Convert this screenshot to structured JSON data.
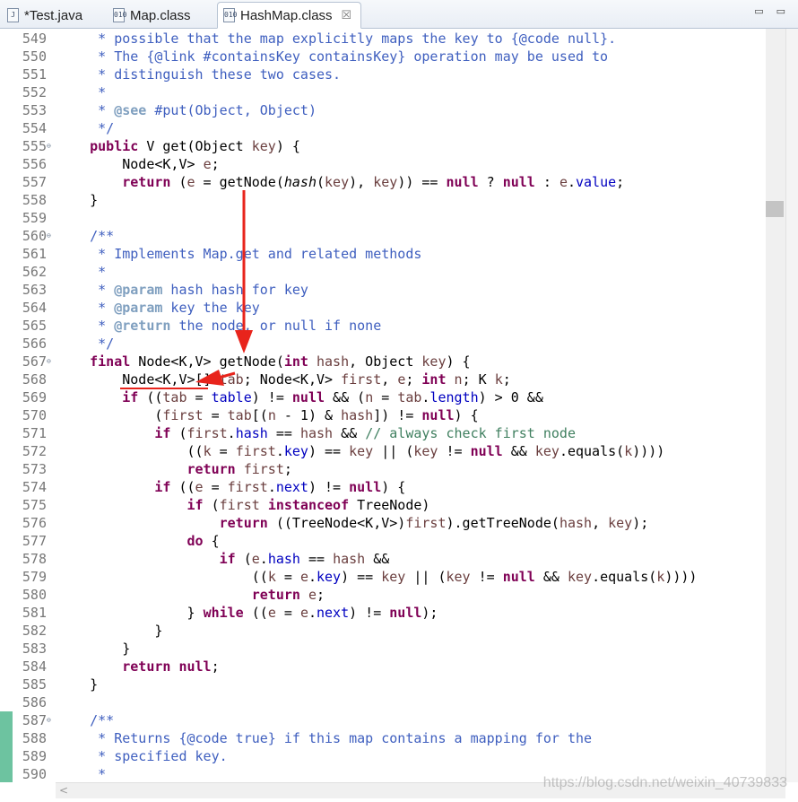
{
  "tabs": [
    {
      "label": "*Test.java",
      "icon": "java-file-icon",
      "icon_glyph": "J",
      "active": false
    },
    {
      "label": "Map.class",
      "icon": "class-file-icon",
      "icon_glyph": "010",
      "active": false
    },
    {
      "label": "HashMap.class",
      "icon": "class-file-icon",
      "icon_glyph": "010",
      "active": true,
      "close": "☒"
    }
  ],
  "window_buttons": {
    "minimize": "▭",
    "maximize": "▭"
  },
  "editor": {
    "lines": [
      {
        "n": "549",
        "fold": "",
        "segs": [
          [
            "cm",
            "     * possible that the map explicitly maps the key to {@code null}."
          ]
        ]
      },
      {
        "n": "550",
        "fold": "",
        "segs": [
          [
            "cm",
            "     * The {@link #containsKey containsKey} operation may be used to"
          ]
        ]
      },
      {
        "n": "551",
        "fold": "",
        "segs": [
          [
            "cm",
            "     * distinguish these two cases."
          ]
        ]
      },
      {
        "n": "552",
        "fold": "",
        "segs": [
          [
            "cm",
            "     *"
          ]
        ]
      },
      {
        "n": "553",
        "fold": "",
        "segs": [
          [
            "cm",
            "     * "
          ],
          [
            "tag",
            "@see"
          ],
          [
            "cm",
            " #put(Object, Object)"
          ]
        ]
      },
      {
        "n": "554",
        "fold": "",
        "segs": [
          [
            "cm",
            "     */"
          ]
        ]
      },
      {
        "n": "555",
        "fold": "⊖",
        "segs": [
          [
            "",
            "    "
          ],
          [
            "kw",
            "public"
          ],
          [
            "",
            " V get(Object "
          ],
          [
            "var",
            "key"
          ],
          [
            "",
            ") {"
          ]
        ]
      },
      {
        "n": "556",
        "fold": "",
        "segs": [
          [
            "",
            "        Node<K,V> "
          ],
          [
            "var",
            "e"
          ],
          [
            "",
            ";"
          ]
        ]
      },
      {
        "n": "557",
        "fold": "",
        "segs": [
          [
            "",
            "        "
          ],
          [
            "kw",
            "return"
          ],
          [
            "",
            " ("
          ],
          [
            "var",
            "e"
          ],
          [
            "",
            " = getNode("
          ],
          [
            "it",
            "hash"
          ],
          [
            "",
            "("
          ],
          [
            "var",
            "key"
          ],
          [
            "",
            "), "
          ],
          [
            "var",
            "key"
          ],
          [
            "",
            ")) == "
          ],
          [
            "kw",
            "null"
          ],
          [
            "",
            " ? "
          ],
          [
            "kw",
            "null"
          ],
          [
            "",
            " : "
          ],
          [
            "var",
            "e"
          ],
          [
            "",
            "."
          ],
          [
            "fld",
            "value"
          ],
          [
            "",
            ";"
          ]
        ]
      },
      {
        "n": "558",
        "fold": "",
        "segs": [
          [
            "",
            "    }"
          ]
        ]
      },
      {
        "n": "559",
        "fold": "",
        "segs": [
          [
            "",
            ""
          ]
        ]
      },
      {
        "n": "560",
        "fold": "⊖",
        "segs": [
          [
            "cm",
            "    /**"
          ]
        ]
      },
      {
        "n": "561",
        "fold": "",
        "segs": [
          [
            "cm",
            "     * Implements Map.get and related methods"
          ]
        ]
      },
      {
        "n": "562",
        "fold": "",
        "segs": [
          [
            "cm",
            "     *"
          ]
        ]
      },
      {
        "n": "563",
        "fold": "",
        "segs": [
          [
            "cm",
            "     * "
          ],
          [
            "tag",
            "@param"
          ],
          [
            "cm",
            " hash hash for key"
          ]
        ]
      },
      {
        "n": "564",
        "fold": "",
        "segs": [
          [
            "cm",
            "     * "
          ],
          [
            "tag",
            "@param"
          ],
          [
            "cm",
            " key the key"
          ]
        ]
      },
      {
        "n": "565",
        "fold": "",
        "segs": [
          [
            "cm",
            "     * "
          ],
          [
            "tag",
            "@return"
          ],
          [
            "cm",
            " the node, or null if none"
          ]
        ]
      },
      {
        "n": "566",
        "fold": "",
        "segs": [
          [
            "cm",
            "     */"
          ]
        ]
      },
      {
        "n": "567",
        "fold": "⊖",
        "segs": [
          [
            "",
            "    "
          ],
          [
            "kw",
            "final"
          ],
          [
            "",
            " Node<K,V> getNode("
          ],
          [
            "kw",
            "int"
          ],
          [
            "",
            " "
          ],
          [
            "var",
            "hash"
          ],
          [
            "",
            ", Object "
          ],
          [
            "var",
            "key"
          ],
          [
            "",
            ") {"
          ]
        ]
      },
      {
        "n": "568",
        "fold": "",
        "segs": [
          [
            "",
            "        Node<K,V>[] "
          ],
          [
            "var",
            "tab"
          ],
          [
            "",
            "; Node<K,V> "
          ],
          [
            "var",
            "first"
          ],
          [
            "",
            ", "
          ],
          [
            "var",
            "e"
          ],
          [
            "",
            "; "
          ],
          [
            "kw",
            "int"
          ],
          [
            "",
            " "
          ],
          [
            "var",
            "n"
          ],
          [
            "",
            "; K "
          ],
          [
            "var",
            "k"
          ],
          [
            "",
            ";"
          ]
        ]
      },
      {
        "n": "569",
        "fold": "",
        "segs": [
          [
            "",
            "        "
          ],
          [
            "kw",
            "if"
          ],
          [
            "",
            " (("
          ],
          [
            "var",
            "tab"
          ],
          [
            "",
            " = "
          ],
          [
            "fld",
            "table"
          ],
          [
            "",
            ") != "
          ],
          [
            "kw",
            "null"
          ],
          [
            "",
            " && ("
          ],
          [
            "var",
            "n"
          ],
          [
            "",
            " = "
          ],
          [
            "var",
            "tab"
          ],
          [
            "",
            "."
          ],
          [
            "fld",
            "length"
          ],
          [
            "",
            ") > 0 &&"
          ]
        ]
      },
      {
        "n": "570",
        "fold": "",
        "segs": [
          [
            "",
            "            ("
          ],
          [
            "var",
            "first"
          ],
          [
            "",
            " = "
          ],
          [
            "var",
            "tab"
          ],
          [
            "",
            "[("
          ],
          [
            "var",
            "n"
          ],
          [
            "",
            " - 1) & "
          ],
          [
            "var",
            "hash"
          ],
          [
            "",
            "]) != "
          ],
          [
            "kw",
            "null"
          ],
          [
            "",
            ") {"
          ]
        ]
      },
      {
        "n": "571",
        "fold": "",
        "segs": [
          [
            "",
            "            "
          ],
          [
            "kw",
            "if"
          ],
          [
            "",
            " ("
          ],
          [
            "var",
            "first"
          ],
          [
            "",
            "."
          ],
          [
            "fld",
            "hash"
          ],
          [
            "",
            " == "
          ],
          [
            "var",
            "hash"
          ],
          [
            "",
            " && "
          ],
          [
            "gc",
            "// always check first node"
          ]
        ]
      },
      {
        "n": "572",
        "fold": "",
        "segs": [
          [
            "",
            "                (("
          ],
          [
            "var",
            "k"
          ],
          [
            "",
            " = "
          ],
          [
            "var",
            "first"
          ],
          [
            "",
            "."
          ],
          [
            "fld",
            "key"
          ],
          [
            "",
            ") == "
          ],
          [
            "var",
            "key"
          ],
          [
            "",
            " || ("
          ],
          [
            "var",
            "key"
          ],
          [
            "",
            " != "
          ],
          [
            "kw",
            "null"
          ],
          [
            "",
            " && "
          ],
          [
            "var",
            "key"
          ],
          [
            "",
            ".equals("
          ],
          [
            "var",
            "k"
          ],
          [
            "",
            ")))) "
          ]
        ]
      },
      {
        "n": "573",
        "fold": "",
        "segs": [
          [
            "",
            "                "
          ],
          [
            "kw",
            "return"
          ],
          [
            "",
            " "
          ],
          [
            "var",
            "first"
          ],
          [
            "",
            ";"
          ]
        ]
      },
      {
        "n": "574",
        "fold": "",
        "segs": [
          [
            "",
            "            "
          ],
          [
            "kw",
            "if"
          ],
          [
            "",
            " (("
          ],
          [
            "var",
            "e"
          ],
          [
            "",
            " = "
          ],
          [
            "var",
            "first"
          ],
          [
            "",
            "."
          ],
          [
            "fld",
            "next"
          ],
          [
            "",
            ") != "
          ],
          [
            "kw",
            "null"
          ],
          [
            "",
            ") {"
          ]
        ]
      },
      {
        "n": "575",
        "fold": "",
        "segs": [
          [
            "",
            "                "
          ],
          [
            "kw",
            "if"
          ],
          [
            "",
            " ("
          ],
          [
            "var",
            "first"
          ],
          [
            "",
            " "
          ],
          [
            "kw",
            "instanceof"
          ],
          [
            "",
            " TreeNode)"
          ]
        ]
      },
      {
        "n": "576",
        "fold": "",
        "segs": [
          [
            "",
            "                    "
          ],
          [
            "kw",
            "return"
          ],
          [
            "",
            " ((TreeNode<K,V>)"
          ],
          [
            "var",
            "first"
          ],
          [
            "",
            ").getTreeNode("
          ],
          [
            "var",
            "hash"
          ],
          [
            "",
            ", "
          ],
          [
            "var",
            "key"
          ],
          [
            "",
            ");"
          ]
        ]
      },
      {
        "n": "577",
        "fold": "",
        "segs": [
          [
            "",
            "                "
          ],
          [
            "kw",
            "do"
          ],
          [
            "",
            " {"
          ]
        ]
      },
      {
        "n": "578",
        "fold": "",
        "segs": [
          [
            "",
            "                    "
          ],
          [
            "kw",
            "if"
          ],
          [
            "",
            " ("
          ],
          [
            "var",
            "e"
          ],
          [
            "",
            "."
          ],
          [
            "fld",
            "hash"
          ],
          [
            "",
            " == "
          ],
          [
            "var",
            "hash"
          ],
          [
            "",
            " &&"
          ]
        ]
      },
      {
        "n": "579",
        "fold": "",
        "segs": [
          [
            "",
            "                        (("
          ],
          [
            "var",
            "k"
          ],
          [
            "",
            " = "
          ],
          [
            "var",
            "e"
          ],
          [
            "",
            "."
          ],
          [
            "fld",
            "key"
          ],
          [
            "",
            ") == "
          ],
          [
            "var",
            "key"
          ],
          [
            "",
            " || ("
          ],
          [
            "var",
            "key"
          ],
          [
            "",
            " != "
          ],
          [
            "kw",
            "null"
          ],
          [
            "",
            " && "
          ],
          [
            "var",
            "key"
          ],
          [
            "",
            ".equals("
          ],
          [
            "var",
            "k"
          ],
          [
            "",
            "))))"
          ]
        ]
      },
      {
        "n": "580",
        "fold": "",
        "segs": [
          [
            "",
            "                        "
          ],
          [
            "kw",
            "return"
          ],
          [
            "",
            " "
          ],
          [
            "var",
            "e"
          ],
          [
            "",
            ";"
          ]
        ]
      },
      {
        "n": "581",
        "fold": "",
        "segs": [
          [
            "",
            "                } "
          ],
          [
            "kw",
            "while"
          ],
          [
            "",
            " (("
          ],
          [
            "var",
            "e"
          ],
          [
            "",
            " = "
          ],
          [
            "var",
            "e"
          ],
          [
            "",
            "."
          ],
          [
            "fld",
            "next"
          ],
          [
            "",
            ") != "
          ],
          [
            "kw",
            "null"
          ],
          [
            "",
            ");"
          ]
        ]
      },
      {
        "n": "582",
        "fold": "",
        "segs": [
          [
            "",
            "            }"
          ]
        ]
      },
      {
        "n": "583",
        "fold": "",
        "segs": [
          [
            "",
            "        }"
          ]
        ]
      },
      {
        "n": "584",
        "fold": "",
        "segs": [
          [
            "",
            "        "
          ],
          [
            "kw",
            "return"
          ],
          [
            "",
            " "
          ],
          [
            "kw",
            "null"
          ],
          [
            "",
            ";"
          ]
        ]
      },
      {
        "n": "585",
        "fold": "",
        "segs": [
          [
            "",
            "    }"
          ]
        ]
      },
      {
        "n": "586",
        "fold": "",
        "segs": [
          [
            "",
            ""
          ]
        ]
      },
      {
        "n": "587",
        "fold": "⊖",
        "changed": true,
        "segs": [
          [
            "cm",
            "    /**"
          ]
        ]
      },
      {
        "n": "588",
        "fold": "",
        "changed": true,
        "segs": [
          [
            "cm",
            "     * Returns {@code true} if this map contains a mapping for the"
          ]
        ]
      },
      {
        "n": "589",
        "fold": "",
        "changed": true,
        "segs": [
          [
            "cm",
            "     * specified key."
          ]
        ]
      },
      {
        "n": "590",
        "fold": "",
        "changed": true,
        "segs": [
          [
            "cm",
            "     *"
          ]
        ]
      }
    ]
  },
  "scroll_left_glyph": "<",
  "watermark": "https://blog.csdn.net/weixin_40739833",
  "colors": {
    "annotation": "#e8241c",
    "keyword": "#7f0055",
    "comment": "#3f5fbf",
    "field": "#0000c0"
  }
}
